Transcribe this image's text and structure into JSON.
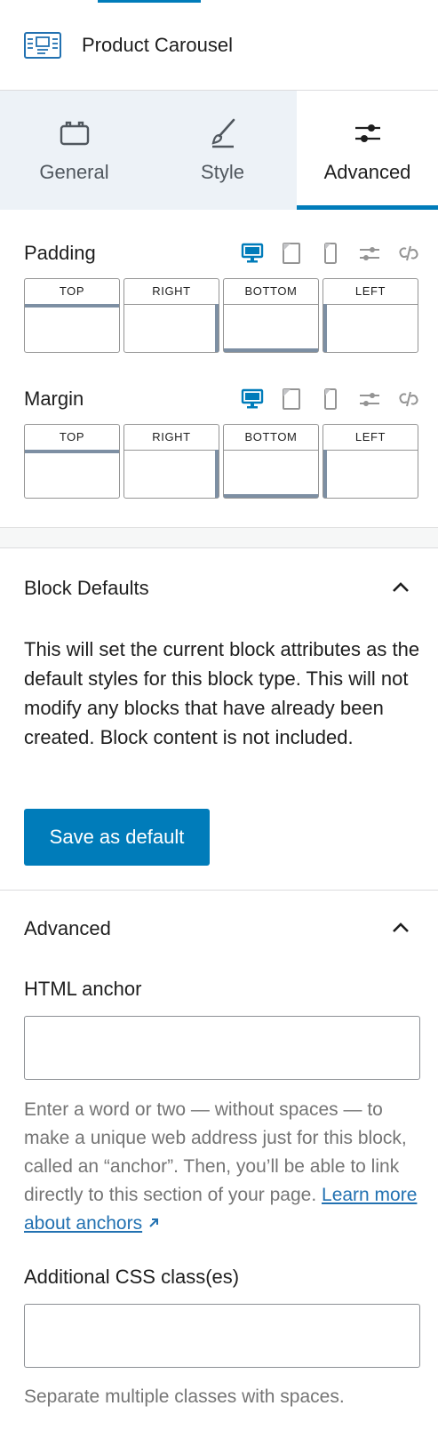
{
  "block": {
    "title": "Product Carousel",
    "icon": "product-carousel-icon"
  },
  "tabs": [
    {
      "label": "General",
      "icon": "toolbox-icon"
    },
    {
      "label": "Style",
      "icon": "brush-icon"
    },
    {
      "label": "Advanced",
      "icon": "sliders-icon",
      "active": true
    }
  ],
  "padding": {
    "label": "Padding",
    "sides": [
      "TOP",
      "RIGHT",
      "BOTTOM",
      "LEFT"
    ]
  },
  "margin": {
    "label": "Margin",
    "sides": [
      "TOP",
      "RIGHT",
      "BOTTOM",
      "LEFT"
    ]
  },
  "device_icons": [
    "desktop-icon",
    "tablet-icon",
    "mobile-icon",
    "sliders-icon",
    "unlink-icon"
  ],
  "block_defaults": {
    "title": "Block Defaults",
    "description": "This will set the current block attributes as the default styles for this block type. This will not modify any blocks that have already been created. Block content is not included.",
    "button_label": "Save as default"
  },
  "advanced": {
    "title": "Advanced",
    "html_anchor": {
      "label": "HTML anchor",
      "value": "",
      "help": "Enter a word or two — without spaces — to make a unique web address just for this block, called an “anchor”. Then, you’ll be able to link directly to this section of your page.",
      "link_text": "Learn more about anchors"
    },
    "css_class": {
      "label": "Additional CSS class(es)",
      "value": "",
      "help": "Separate multiple classes with spaces."
    }
  },
  "colors": {
    "accent": "#007cba",
    "text": "#1e1e1e",
    "muted": "#757575",
    "tab_bg": "#edf2f7"
  }
}
